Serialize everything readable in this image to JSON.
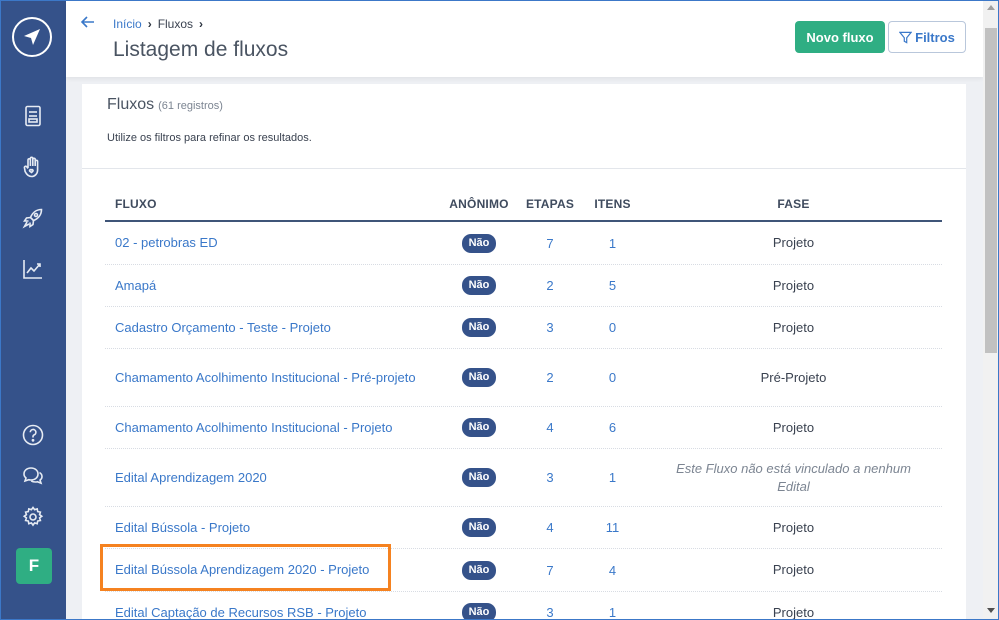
{
  "breadcrumb": {
    "home": "Início",
    "current": "Fluxos"
  },
  "page_title": "Listagem de fluxos",
  "buttons": {
    "new_flow": "Novo fluxo",
    "filters": "Filtros"
  },
  "card": {
    "title": "Fluxos",
    "count": "(61 registros)",
    "subtitle": "Utilize os filtros para refinar os resultados."
  },
  "table": {
    "headers": {
      "flow": "FLUXO",
      "anon": "ANÔNIMO",
      "steps": "ETAPAS",
      "items": "ITENS",
      "phase": "FASE"
    },
    "rows": [
      {
        "flow": "02 - petrobras ED",
        "anon": "Não",
        "steps": "7",
        "items": "1",
        "phase": "Projeto"
      },
      {
        "flow": "Amapá",
        "anon": "Não",
        "steps": "2",
        "items": "5",
        "phase": "Projeto"
      },
      {
        "flow": "Cadastro Orçamento - Teste - Projeto",
        "anon": "Não",
        "steps": "3",
        "items": "0",
        "phase": "Projeto"
      },
      {
        "flow": "Chamamento Acolhimento Institucional - Pré-projeto",
        "anon": "Não",
        "steps": "2",
        "items": "0",
        "phase": "Pré-Projeto"
      },
      {
        "flow": "Chamamento Acolhimento Institucional - Projeto",
        "anon": "Não",
        "steps": "4",
        "items": "6",
        "phase": "Projeto"
      },
      {
        "flow": "Edital Aprendizagem 2020",
        "anon": "Não",
        "steps": "3",
        "items": "1",
        "phase": "Este Fluxo não está vinculado a nenhum Edital"
      },
      {
        "flow": "Edital Bússola - Projeto",
        "anon": "Não",
        "steps": "4",
        "items": "11",
        "phase": "Projeto"
      },
      {
        "flow": "Edital Bússola Aprendizagem 2020 - Projeto",
        "anon": "Não",
        "steps": "7",
        "items": "4",
        "phase": "Projeto"
      },
      {
        "flow": "Edital Captação de Recursos RSB - Projeto",
        "anon": "Não",
        "steps": "3",
        "items": "1",
        "phase": "Projeto"
      }
    ]
  },
  "user": {
    "initial": "F"
  },
  "colors": {
    "sidebar": "#35528a",
    "accent_green": "#2fae83",
    "link_blue": "#3a78c9",
    "highlight": "#f58220"
  }
}
